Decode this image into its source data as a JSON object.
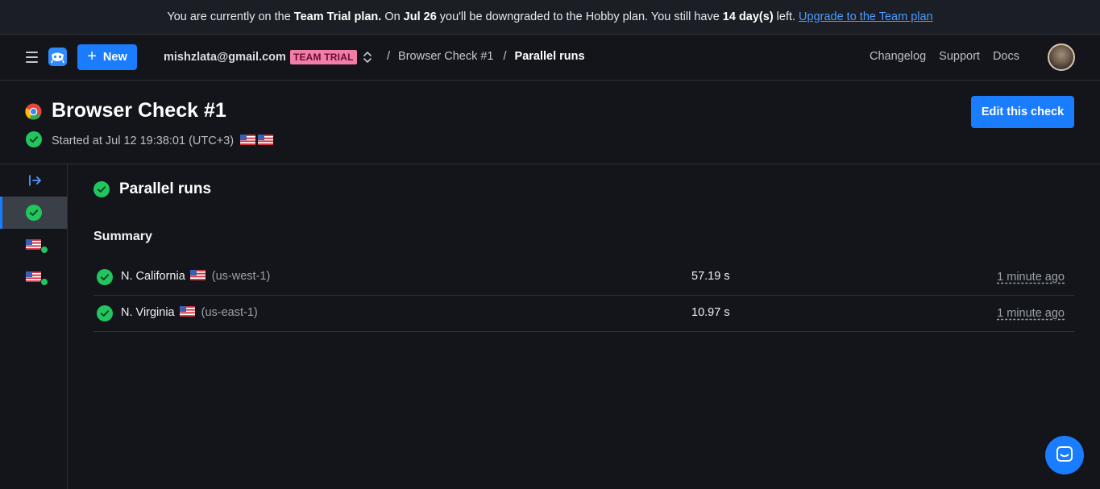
{
  "banner": {
    "part1": "You are currently on the",
    "plan": "Team Trial plan.",
    "part2": "On",
    "date": "Jul 26",
    "part3": "you'll be downgraded to the Hobby plan. You still have",
    "days": "14 day(s)",
    "part4": "left.",
    "link": "Upgrade to the Team plan"
  },
  "header": {
    "new_label": "New",
    "email": "mishzlata@gmail.com",
    "badge": "TEAM TRIAL",
    "breadcrumb": [
      {
        "label": "Browser Check #1"
      },
      {
        "label": "Parallel runs"
      }
    ],
    "links": [
      "Changelog",
      "Support",
      "Docs"
    ]
  },
  "page": {
    "title": "Browser Check #1",
    "started": "Started at Jul 12 19:38:01 (UTC+3)",
    "edit_label": "Edit this check"
  },
  "run": {
    "title": "Parallel runs",
    "summary_label": "Summary",
    "rows": [
      {
        "name": "N. California",
        "region": "(us-west-1)",
        "duration": "57.19 s",
        "ago": "1 minute ago"
      },
      {
        "name": "N. Virginia",
        "region": "(us-east-1)",
        "duration": "10.97 s",
        "ago": "1 minute ago"
      }
    ]
  },
  "colors": {
    "accent": "#1a7cff",
    "success": "#22c55e",
    "badge_bg": "#f17ea5",
    "background": "#13151b"
  },
  "icons": [
    "menu-icon",
    "logo-icon",
    "plus-icon",
    "chevron-updown-icon",
    "chrome-icon",
    "check-circle-icon",
    "us-flag-icon",
    "expand-sidebar-icon",
    "chat-icon"
  ]
}
